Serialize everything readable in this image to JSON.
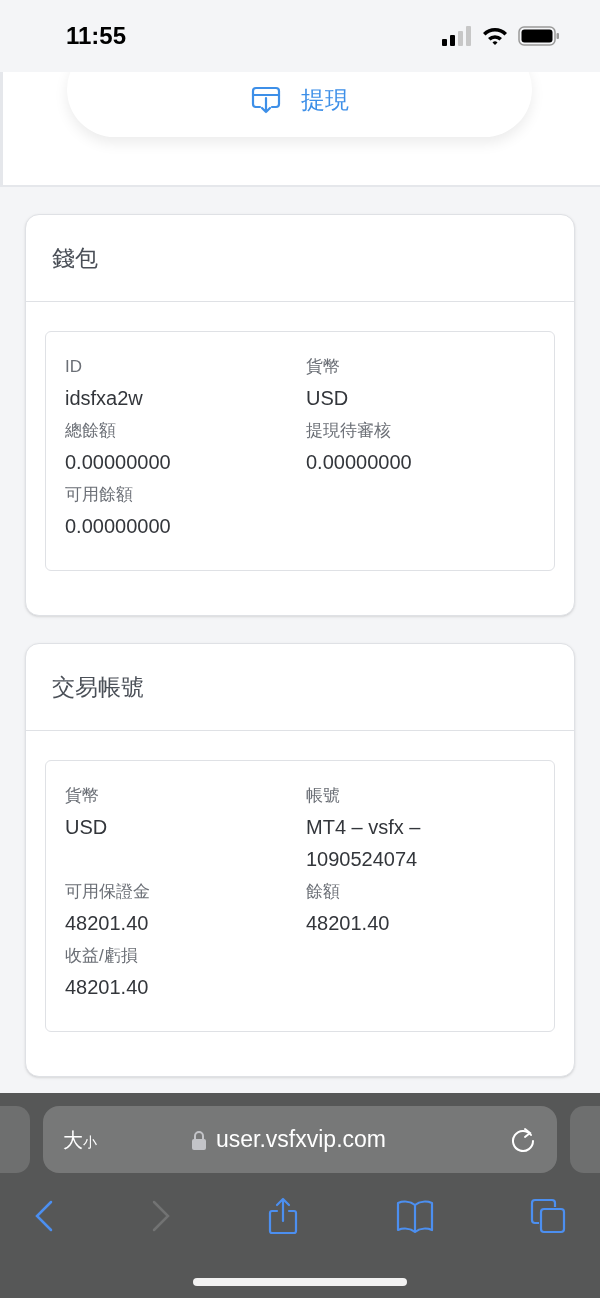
{
  "status_bar": {
    "time": "11:55"
  },
  "withdraw_button": {
    "label": "提現"
  },
  "wallet": {
    "title": "錢包",
    "fields": [
      {
        "label": "ID",
        "value": "idsfxa2w"
      },
      {
        "label": "貨幣",
        "value": "USD"
      },
      {
        "label": "總餘額",
        "value": "0.00000000"
      },
      {
        "label": "提現待審核",
        "value": "0.00000000"
      },
      {
        "label": "可用餘額",
        "value": "0.00000000"
      }
    ]
  },
  "trading_account": {
    "title": "交易帳號",
    "fields": [
      {
        "label": "貨幣",
        "value": "USD"
      },
      {
        "label": "帳號",
        "value": "MT4 – vsfx – 1090524074"
      },
      {
        "label": "可用保證金",
        "value": "48201.40"
      },
      {
        "label": "餘額",
        "value": "48201.40"
      },
      {
        "label": "收益/虧損",
        "value": "48201.40"
      }
    ]
  },
  "browser": {
    "text_size_button": {
      "large": "大",
      "small": "小"
    },
    "url": "user.vsfxvip.com"
  }
}
